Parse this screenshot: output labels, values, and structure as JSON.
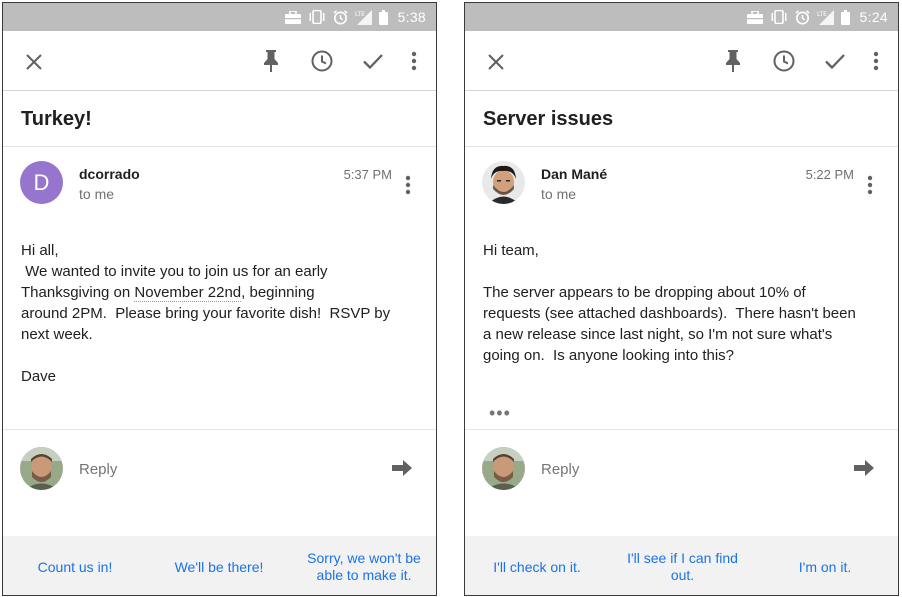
{
  "colors": {
    "status_bar": "#bdbdbd",
    "accent": "#1a73e8",
    "avatar_letter_bg": "#9575cd",
    "smart_reply_bg": "#f2f2f2"
  },
  "screens": [
    {
      "status": {
        "time": "5:38",
        "network": "LTE"
      },
      "toolbar_icons": [
        "close-icon",
        "pin-icon",
        "snooze-clock-icon",
        "check-icon",
        "more-vert-icon"
      ],
      "subject": "Turkey!",
      "message": {
        "avatar_letter": "D",
        "sender": "dcorrado",
        "recipient": "to me",
        "time": "5:37 PM",
        "body_greeting": "Hi all,",
        "body_part1": " We wanted to invite you to join us for an early\nThanksgiving on ",
        "body_date": "November 22nd",
        "body_part2": ", beginning\naround 2PM.  Please bring your favorite dish!  RSVP by\nnext week.\n\nDave"
      },
      "reply": {
        "label": "Reply"
      },
      "smart_replies": [
        "Count us in!",
        "We'll be there!",
        "Sorry, we won't be able to make it."
      ]
    },
    {
      "status": {
        "time": "5:24",
        "network": "LTE"
      },
      "toolbar_icons": [
        "close-icon",
        "pin-icon",
        "snooze-clock-icon",
        "check-icon",
        "more-vert-icon"
      ],
      "subject": "Server issues",
      "message": {
        "sender": "Dan Mané",
        "recipient": "to me",
        "time": "5:22 PM",
        "body": "Hi team,\n\nThe server appears to be dropping about 10% of\nrequests (see attached dashboards).  There hasn't been\na new release since last night, so I'm not sure what's\ngoing on.  Is anyone looking into this?",
        "collapsed_indicator": "•••"
      },
      "reply": {
        "label": "Reply"
      },
      "smart_replies": [
        "I'll check on it.",
        "I'll see if I can find out.",
        "I'm on it."
      ]
    }
  ]
}
